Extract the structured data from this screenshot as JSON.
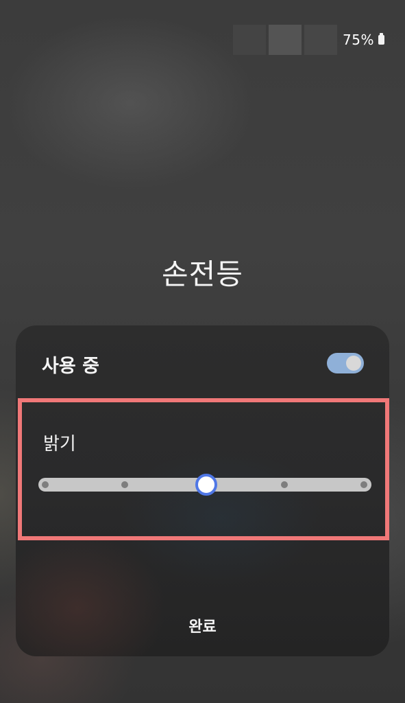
{
  "status_bar": {
    "battery_percent": "75%",
    "battery_icon": "battery-icon"
  },
  "title": "손전등",
  "panel": {
    "in_use_label": "사용 중",
    "toggle_on": true,
    "toggle_color": "#8fb0d8",
    "brightness_label": "밝기",
    "brightness": {
      "levels": 5,
      "current_level": 3
    },
    "highlight_color": "#f07878",
    "done_label": "완료"
  }
}
